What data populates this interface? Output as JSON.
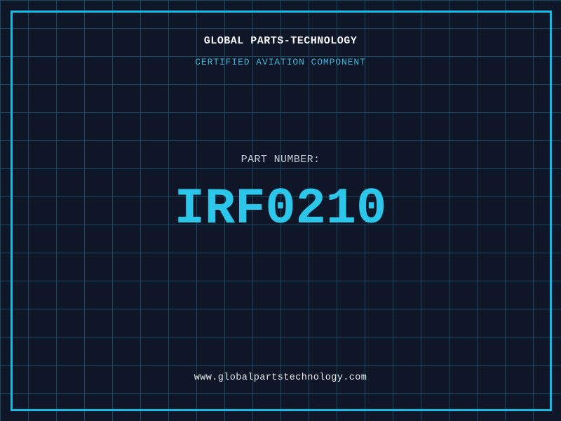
{
  "colors": {
    "background": "#0e1627",
    "grid_line": "#1b4a5f",
    "frame": "#12bce4",
    "title": "#f5f7f9",
    "subtitle": "#41b7da",
    "part_label": "#c6cdd7",
    "part_number": "#2bc6ea",
    "url": "#e9ecef"
  },
  "header": {
    "title": "GLOBAL PARTS-TECHNOLOGY",
    "subtitle": "CERTIFIED AVIATION COMPONENT"
  },
  "part": {
    "label": "PART NUMBER:",
    "number": "IRF0210"
  },
  "footer": {
    "url": "www.globalpartstechnology.com"
  }
}
